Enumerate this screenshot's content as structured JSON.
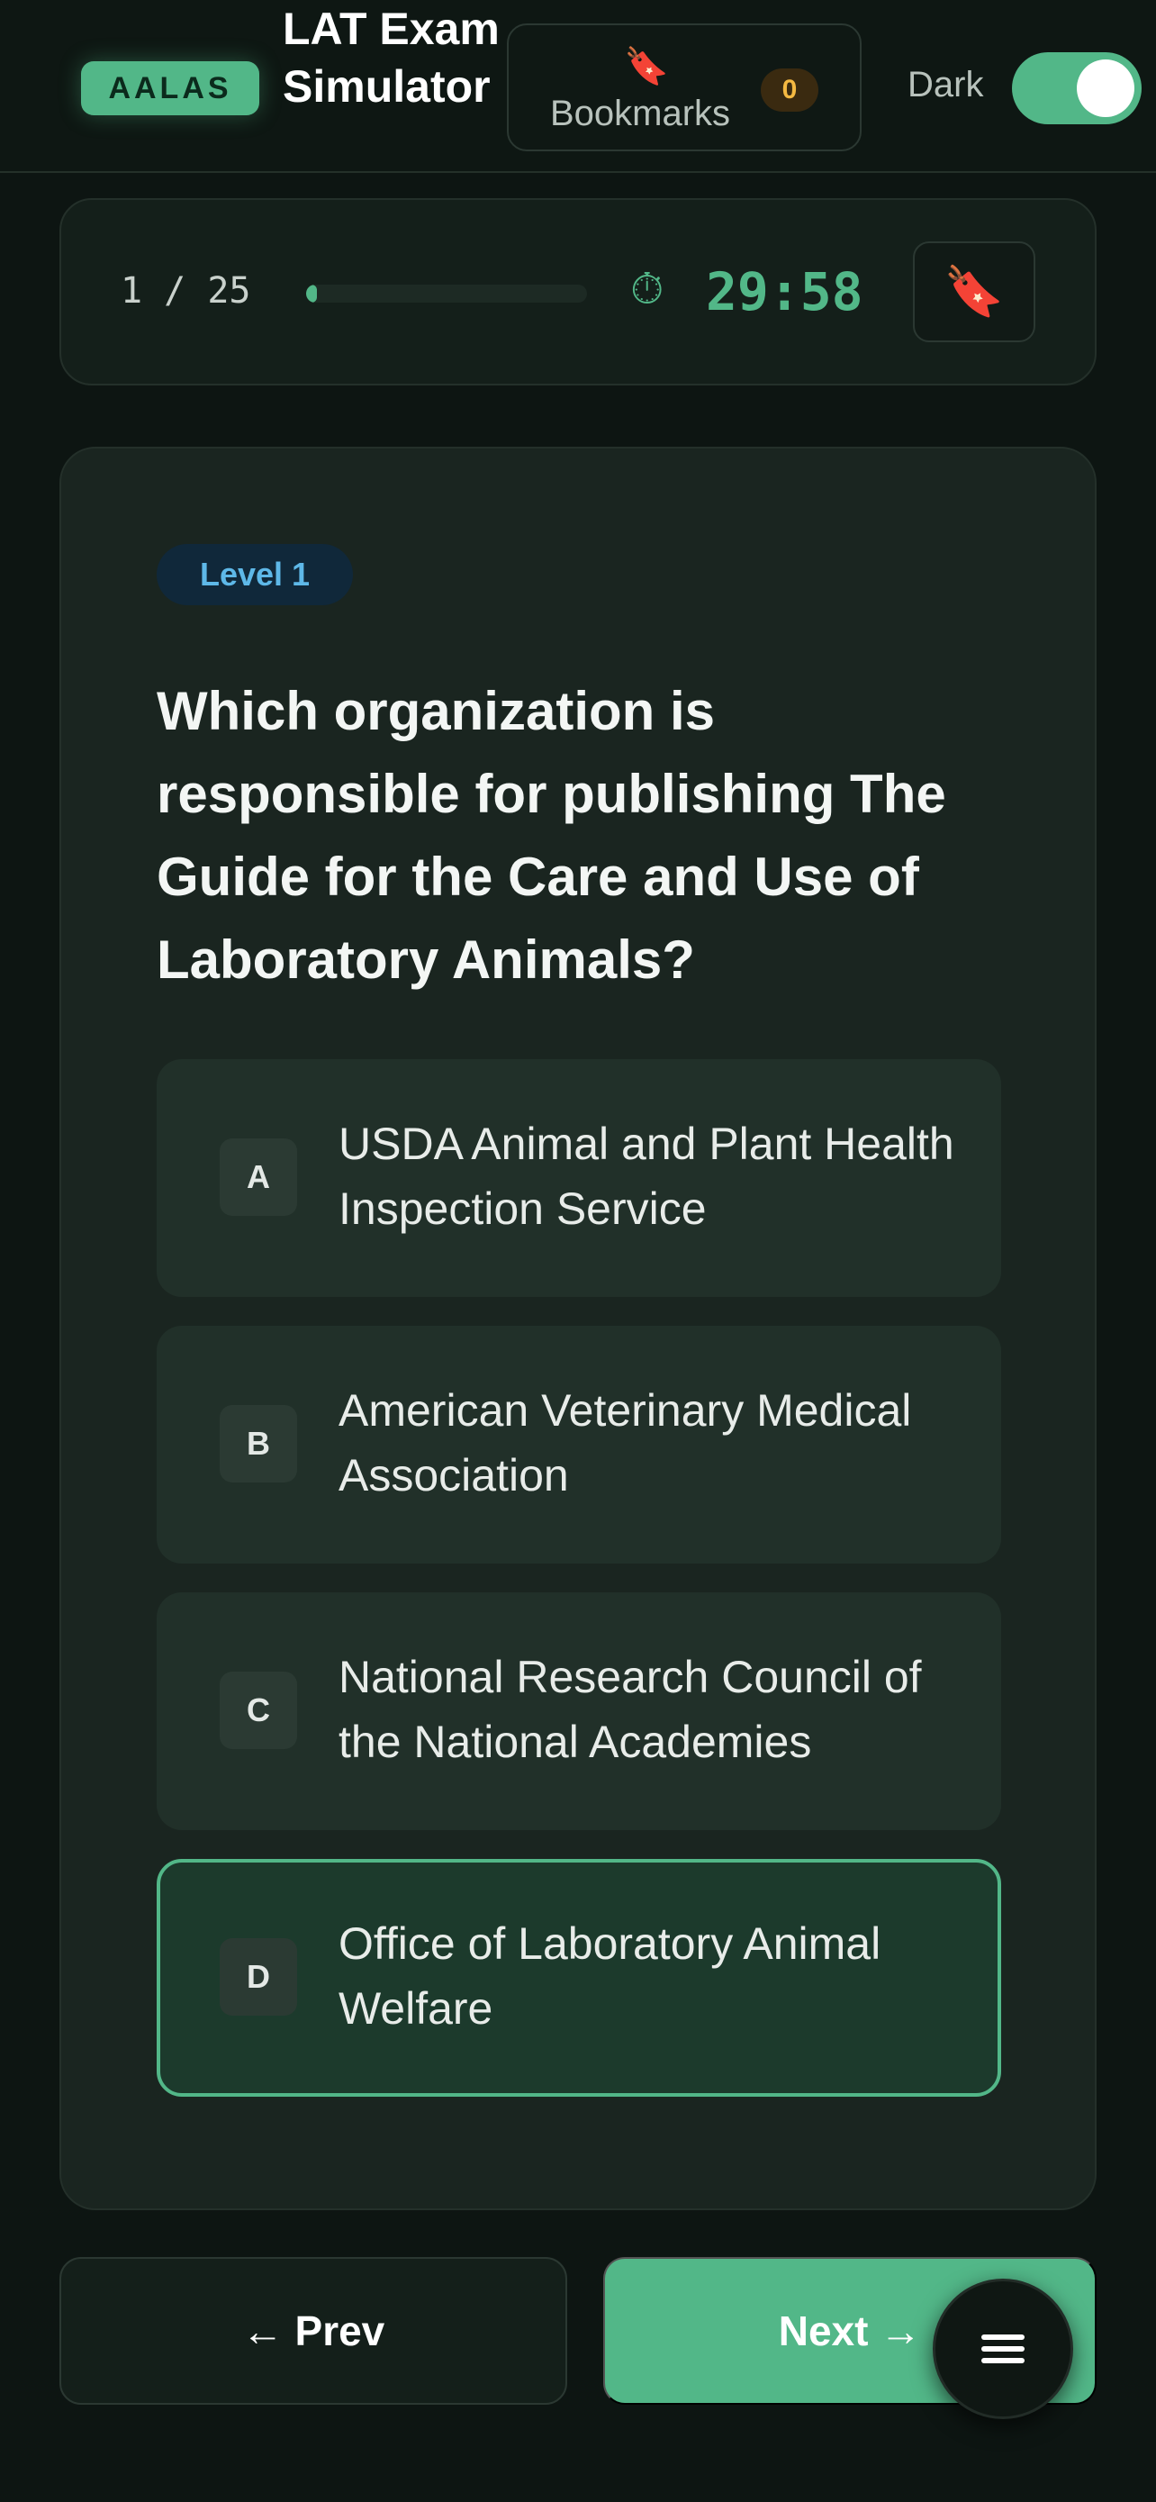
{
  "header": {
    "brand_badge": "AALAS",
    "title": "LAT Exam Simulator",
    "bookmarks": {
      "icon": "bookmark-icon",
      "label": "Bookmarks",
      "count": "0"
    },
    "theme_toggle": {
      "label": "Dark",
      "on": true
    }
  },
  "progress": {
    "counter": "1 / 25",
    "fraction": 0.04,
    "timer_icon": "stopwatch-icon",
    "timer": "29:58",
    "bookmark_icon": "bookmark-icon"
  },
  "question": {
    "level": "Level 1",
    "text": "Which organization is responsible for publishing The Guide for the Care and Use of Laboratory Animals?",
    "options": [
      {
        "letter": "A",
        "text": "USDA Animal and Plant Health Inspection Service",
        "selected": false
      },
      {
        "letter": "B",
        "text": "American Veterinary Medical Association",
        "selected": false
      },
      {
        "letter": "C",
        "text": "National Research Council of the National Academies",
        "selected": false
      },
      {
        "letter": "D",
        "text": "Office of Laboratory Animal Welfare",
        "selected": true
      }
    ]
  },
  "nav": {
    "prev_label": "← Prev",
    "next_label": "Next →",
    "menu_icon": "menu-icon"
  },
  "colors": {
    "accent": "#52b788",
    "background": "#0d1512",
    "card": "#1a2520",
    "bookmark_red": "#e8423b",
    "level_blue": "#5eb8e8",
    "count_amber": "#f4b942"
  }
}
